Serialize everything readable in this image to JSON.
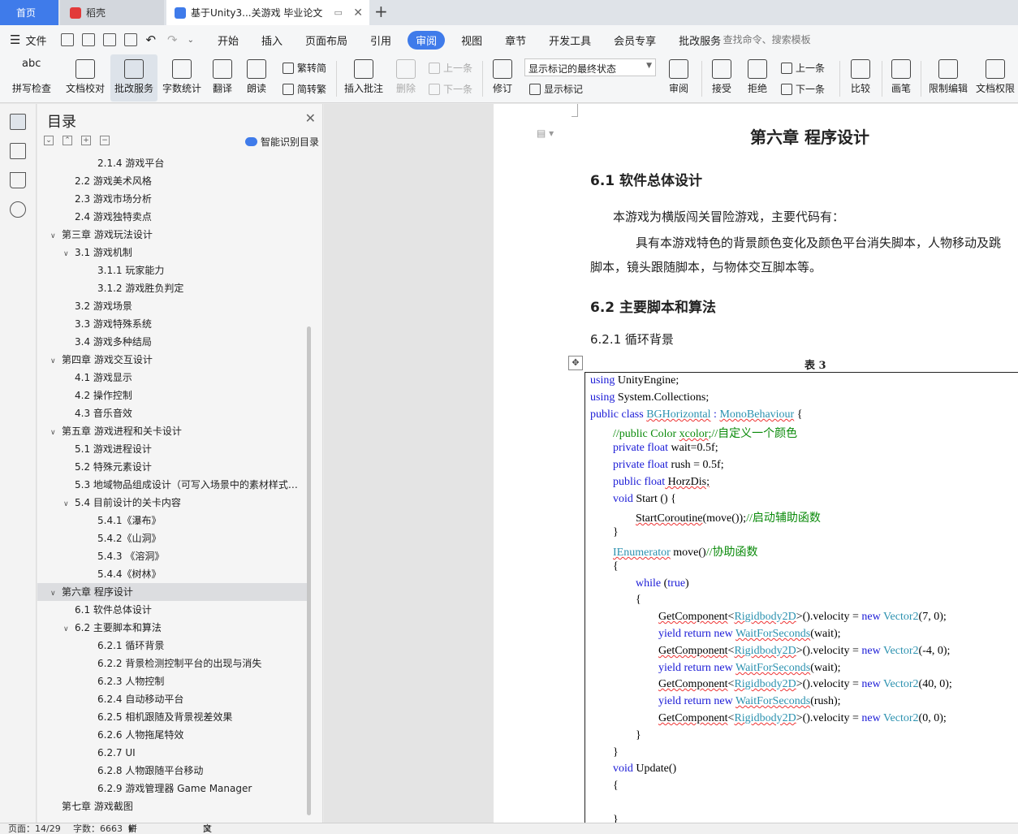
{
  "tabs": {
    "home": "首页",
    "daoke": "稻壳",
    "doc": "基于Unity3...关游戏 毕业论文",
    "add": "+"
  },
  "menu": {
    "file": "文件",
    "items": [
      "开始",
      "插入",
      "页面布局",
      "引用",
      "审阅",
      "视图",
      "章节",
      "开发工具",
      "会员专享",
      "批改服务"
    ],
    "search": "查找命令、搜索模板"
  },
  "ribbon": {
    "spell": "拼写检查",
    "proof": "文档校对",
    "correct": "批改服务",
    "count": "字数统计",
    "translate": "翻译",
    "read": "朗读",
    "trad": "繁转简",
    "simp": "简转繁",
    "insert_comment": "插入批注",
    "delete": "删除",
    "prev": "上一条",
    "next": "下一条",
    "revise": "修订",
    "status_value": "显示标记的最终状态",
    "show_marks": "显示标记",
    "review": "审阅",
    "accept": "接受",
    "reject": "拒绝",
    "prev2": "上一条",
    "next2": "下一条",
    "compare": "比较",
    "pen": "画笔",
    "restrict": "限制编辑",
    "perm": "文档权限"
  },
  "toc": {
    "title": "目录",
    "smart": "智能识别目录",
    "items": [
      {
        "text": "2.1.4 游戏平台",
        "level": 3,
        "chev": ""
      },
      {
        "text": "2.2 游戏美术风格",
        "level": 2,
        "chev": ""
      },
      {
        "text": "2.3 游戏市场分析",
        "level": 2,
        "chev": ""
      },
      {
        "text": "2.4 游戏独特卖点",
        "level": 2,
        "chev": ""
      },
      {
        "text": "第三章  游戏玩法设计",
        "level": 1,
        "chev": "∨"
      },
      {
        "text": "3.1 游戏机制",
        "level": 2,
        "chev": "∨"
      },
      {
        "text": "3.1.1 玩家能力",
        "level": 3,
        "chev": ""
      },
      {
        "text": "3.1.2 游戏胜负判定",
        "level": 3,
        "chev": ""
      },
      {
        "text": "3.2 游戏场景",
        "level": 2,
        "chev": ""
      },
      {
        "text": "3.3 游戏特殊系统",
        "level": 2,
        "chev": ""
      },
      {
        "text": "3.4 游戏多种结局",
        "level": 2,
        "chev": ""
      },
      {
        "text": "第四章  游戏交互设计",
        "level": 1,
        "chev": "∨"
      },
      {
        "text": "4.1 游戏显示",
        "level": 2,
        "chev": ""
      },
      {
        "text": "4.2 操作控制",
        "level": 2,
        "chev": ""
      },
      {
        "text": "4.3 音乐音效",
        "level": 2,
        "chev": ""
      },
      {
        "text": "第五章  游戏进程和关卡设计",
        "level": 1,
        "chev": "∨"
      },
      {
        "text": "5.1 游戏进程设计",
        "level": 2,
        "chev": ""
      },
      {
        "text": "5.2  特殊元素设计",
        "level": 2,
        "chev": ""
      },
      {
        "text": "5.3 地域物品组成设计（可写入场景中的素材样式…",
        "level": 2,
        "chev": ""
      },
      {
        "text": "5.4 目前设计的关卡内容",
        "level": 2,
        "chev": "∨"
      },
      {
        "text": "5.4.1《瀑布》",
        "level": 3,
        "chev": ""
      },
      {
        "text": "5.4.2《山洞》",
        "level": 3,
        "chev": ""
      },
      {
        "text": "5.4.3  《溶洞》",
        "level": 3,
        "chev": ""
      },
      {
        "text": "5.4.4《树林》",
        "level": 3,
        "chev": ""
      },
      {
        "text": "第六章  程序设计",
        "level": 1,
        "chev": "∨"
      },
      {
        "text": "6.1 软件总体设计",
        "level": 2,
        "chev": ""
      },
      {
        "text": "6.2 主要脚本和算法",
        "level": 2,
        "chev": "∨"
      },
      {
        "text": "6.2.1 循环背景",
        "level": 3,
        "chev": ""
      },
      {
        "text": "6.2.2 背景检测控制平台的出现与消失",
        "level": 3,
        "chev": ""
      },
      {
        "text": "6.2.3 人物控制",
        "level": 3,
        "chev": ""
      },
      {
        "text": "6.2.4 自动移动平台",
        "level": 3,
        "chev": ""
      },
      {
        "text": "6.2.5 相机跟随及背景视差效果",
        "level": 3,
        "chev": ""
      },
      {
        "text": "6.2.6 人物拖尾特效",
        "level": 3,
        "chev": ""
      },
      {
        "text": "6.2.7 UI",
        "level": 3,
        "chev": ""
      },
      {
        "text": "6.2.8  人物跟随平台移动",
        "level": 3,
        "chev": ""
      },
      {
        "text": "6.2.9  游戏管理器 Game Manager",
        "level": 3,
        "chev": ""
      },
      {
        "text": "第七章  游戏截图",
        "level": 1,
        "chev": ""
      }
    ],
    "active_index": 24
  },
  "document": {
    "chapter": "第六章  程序设计",
    "s61": "6.1 软件总体设计",
    "p1": "本游戏为横版闯关冒险游戏，主要代码有：",
    "p2": "具有本游戏特色的背景颜色变化及颜色平台消失脚本，人物移动及跳",
    "p3": "脚本，镜头跟随脚本，与物体交互脚本等。",
    "s62": "6.2 主要脚本和算法",
    "s621": "6.2.1 循环背景",
    "table_caption": "表 3",
    "code": {
      "l1a": "using",
      "l1b": " UnityEngine;",
      "l2a": "using",
      "l2b": " System.Collections;",
      "l3a": "public class",
      "l3b": "BGHorizontal",
      "l3c": " : ",
      "l3d": "MonoBehaviour",
      "l3e": " {",
      "l4a": "//public Color ",
      "l4b": "xcolor",
      "l4c": ";//自定义一个颜色",
      "l5a": "private float",
      "l5b": " wait=0.5f;",
      "l6a": "private float",
      "l6b": " rush = 0.5f;",
      "l7a": "public float",
      "l7b": " HorzDis;",
      "l8a": "void",
      "l8b": " Start () {",
      "l9a": "StartCoroutine",
      "l9b": "(move());",
      "l9c": "//启动辅助函数",
      "l10": "}",
      "l11a": "IEnumerator",
      "l11b": " move()",
      "l11c": "//协助函数",
      "l12": "{",
      "l13a": "while",
      "l13b": " (",
      "l13c": "true",
      "l13d": ")",
      "l14": "{",
      "gc": "GetComponent",
      "rb2d": "Rigidbody2D",
      "vel": ">().velocity = ",
      "new": "new",
      "v2": "Vector2",
      "a1": "(7, 0);",
      "yr": "yield return new",
      "wfs": "WaitForSeconds",
      "w1": "(wait);",
      "a2": "(-4, 0);",
      "w2": "(wait);",
      "a3": "(40, 0);",
      "w3": "(rush);",
      "a4": "(0, 0);",
      "lt": "<",
      "l22": "}",
      "l23": "}",
      "l24a": "void",
      "l24b": " Update()",
      "l25": "{",
      "l26": "}"
    }
  },
  "statusbar": {
    "page": "页面：14/29",
    "words": "字数：6663",
    "spell": "拼写检查",
    "proof": "文档校对"
  }
}
